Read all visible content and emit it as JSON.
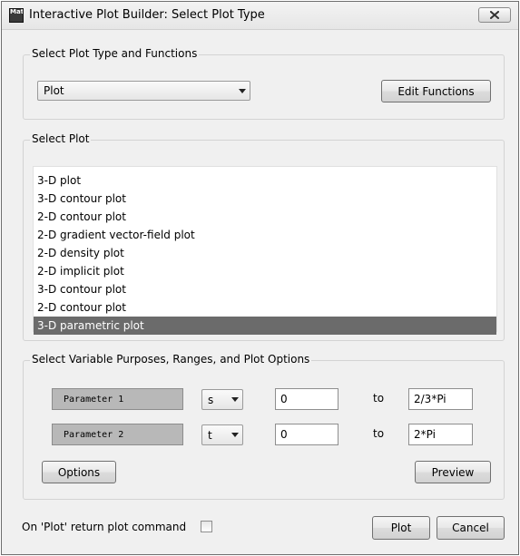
{
  "window": {
    "title": "Interactive Plot Builder: Select Plot Type",
    "app_icon_text": "Mat",
    "close_icon": "close-icon"
  },
  "plot_type_group": {
    "label": "Select Plot Type and Functions",
    "plot_type_value": "Plot",
    "edit_functions_label": "Edit Functions"
  },
  "select_plot_group": {
    "label": "Select Plot",
    "items": [
      "3-D plot",
      "3-D contour plot",
      "2-D contour plot",
      "2-D gradient vector-field plot",
      "2-D density plot",
      "2-D implicit plot",
      "3-D contour plot",
      "2-D contour plot",
      "3-D parametric plot"
    ],
    "selected_index": 8
  },
  "variables_group": {
    "label": "Select Variable Purposes, Ranges, and Plot Options",
    "rows": [
      {
        "purpose": "Parameter 1",
        "variable": "s",
        "from": "0",
        "to_label": "to",
        "to": "2/3*Pi"
      },
      {
        "purpose": "Parameter 2",
        "variable": "t",
        "from": "0",
        "to_label": "to",
        "to": "2*Pi"
      }
    ],
    "options_label": "Options",
    "preview_label": "Preview"
  },
  "footer": {
    "return_command_label": "On 'Plot' return plot command",
    "return_command_checked": false,
    "plot_label": "Plot",
    "cancel_label": "Cancel"
  },
  "colors": {
    "selection": "#6b6b6b",
    "dialog_background": "#f0f0f0",
    "param_label_background": "#b8b8b8"
  }
}
